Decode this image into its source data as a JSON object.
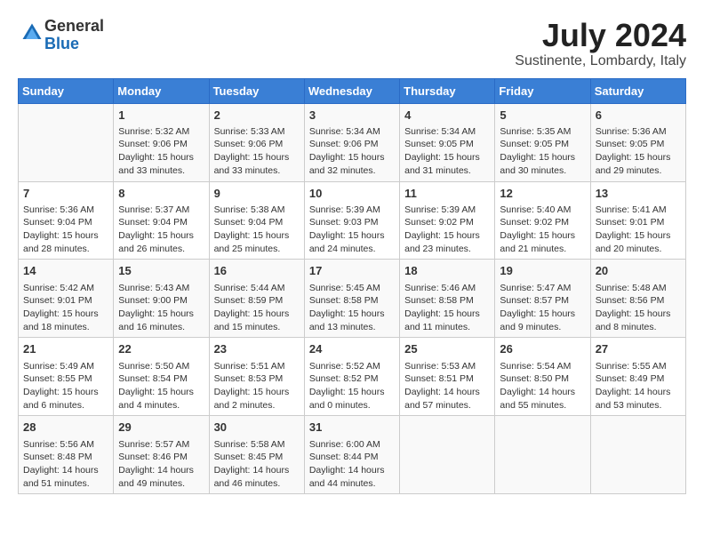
{
  "header": {
    "logo_general": "General",
    "logo_blue": "Blue",
    "main_title": "July 2024",
    "subtitle": "Sustinente, Lombardy, Italy"
  },
  "calendar": {
    "days_of_week": [
      "Sunday",
      "Monday",
      "Tuesday",
      "Wednesday",
      "Thursday",
      "Friday",
      "Saturday"
    ],
    "weeks": [
      [
        {
          "day": "",
          "info": ""
        },
        {
          "day": "1",
          "info": "Sunrise: 5:32 AM\nSunset: 9:06 PM\nDaylight: 15 hours\nand 33 minutes."
        },
        {
          "day": "2",
          "info": "Sunrise: 5:33 AM\nSunset: 9:06 PM\nDaylight: 15 hours\nand 33 minutes."
        },
        {
          "day": "3",
          "info": "Sunrise: 5:34 AM\nSunset: 9:06 PM\nDaylight: 15 hours\nand 32 minutes."
        },
        {
          "day": "4",
          "info": "Sunrise: 5:34 AM\nSunset: 9:05 PM\nDaylight: 15 hours\nand 31 minutes."
        },
        {
          "day": "5",
          "info": "Sunrise: 5:35 AM\nSunset: 9:05 PM\nDaylight: 15 hours\nand 30 minutes."
        },
        {
          "day": "6",
          "info": "Sunrise: 5:36 AM\nSunset: 9:05 PM\nDaylight: 15 hours\nand 29 minutes."
        }
      ],
      [
        {
          "day": "7",
          "info": "Sunrise: 5:36 AM\nSunset: 9:04 PM\nDaylight: 15 hours\nand 28 minutes."
        },
        {
          "day": "8",
          "info": "Sunrise: 5:37 AM\nSunset: 9:04 PM\nDaylight: 15 hours\nand 26 minutes."
        },
        {
          "day": "9",
          "info": "Sunrise: 5:38 AM\nSunset: 9:04 PM\nDaylight: 15 hours\nand 25 minutes."
        },
        {
          "day": "10",
          "info": "Sunrise: 5:39 AM\nSunset: 9:03 PM\nDaylight: 15 hours\nand 24 minutes."
        },
        {
          "day": "11",
          "info": "Sunrise: 5:39 AM\nSunset: 9:02 PM\nDaylight: 15 hours\nand 23 minutes."
        },
        {
          "day": "12",
          "info": "Sunrise: 5:40 AM\nSunset: 9:02 PM\nDaylight: 15 hours\nand 21 minutes."
        },
        {
          "day": "13",
          "info": "Sunrise: 5:41 AM\nSunset: 9:01 PM\nDaylight: 15 hours\nand 20 minutes."
        }
      ],
      [
        {
          "day": "14",
          "info": "Sunrise: 5:42 AM\nSunset: 9:01 PM\nDaylight: 15 hours\nand 18 minutes."
        },
        {
          "day": "15",
          "info": "Sunrise: 5:43 AM\nSunset: 9:00 PM\nDaylight: 15 hours\nand 16 minutes."
        },
        {
          "day": "16",
          "info": "Sunrise: 5:44 AM\nSunset: 8:59 PM\nDaylight: 15 hours\nand 15 minutes."
        },
        {
          "day": "17",
          "info": "Sunrise: 5:45 AM\nSunset: 8:58 PM\nDaylight: 15 hours\nand 13 minutes."
        },
        {
          "day": "18",
          "info": "Sunrise: 5:46 AM\nSunset: 8:58 PM\nDaylight: 15 hours\nand 11 minutes."
        },
        {
          "day": "19",
          "info": "Sunrise: 5:47 AM\nSunset: 8:57 PM\nDaylight: 15 hours\nand 9 minutes."
        },
        {
          "day": "20",
          "info": "Sunrise: 5:48 AM\nSunset: 8:56 PM\nDaylight: 15 hours\nand 8 minutes."
        }
      ],
      [
        {
          "day": "21",
          "info": "Sunrise: 5:49 AM\nSunset: 8:55 PM\nDaylight: 15 hours\nand 6 minutes."
        },
        {
          "day": "22",
          "info": "Sunrise: 5:50 AM\nSunset: 8:54 PM\nDaylight: 15 hours\nand 4 minutes."
        },
        {
          "day": "23",
          "info": "Sunrise: 5:51 AM\nSunset: 8:53 PM\nDaylight: 15 hours\nand 2 minutes."
        },
        {
          "day": "24",
          "info": "Sunrise: 5:52 AM\nSunset: 8:52 PM\nDaylight: 15 hours\nand 0 minutes."
        },
        {
          "day": "25",
          "info": "Sunrise: 5:53 AM\nSunset: 8:51 PM\nDaylight: 14 hours\nand 57 minutes."
        },
        {
          "day": "26",
          "info": "Sunrise: 5:54 AM\nSunset: 8:50 PM\nDaylight: 14 hours\nand 55 minutes."
        },
        {
          "day": "27",
          "info": "Sunrise: 5:55 AM\nSunset: 8:49 PM\nDaylight: 14 hours\nand 53 minutes."
        }
      ],
      [
        {
          "day": "28",
          "info": "Sunrise: 5:56 AM\nSunset: 8:48 PM\nDaylight: 14 hours\nand 51 minutes."
        },
        {
          "day": "29",
          "info": "Sunrise: 5:57 AM\nSunset: 8:46 PM\nDaylight: 14 hours\nand 49 minutes."
        },
        {
          "day": "30",
          "info": "Sunrise: 5:58 AM\nSunset: 8:45 PM\nDaylight: 14 hours\nand 46 minutes."
        },
        {
          "day": "31",
          "info": "Sunrise: 6:00 AM\nSunset: 8:44 PM\nDaylight: 14 hours\nand 44 minutes."
        },
        {
          "day": "",
          "info": ""
        },
        {
          "day": "",
          "info": ""
        },
        {
          "day": "",
          "info": ""
        }
      ]
    ]
  }
}
